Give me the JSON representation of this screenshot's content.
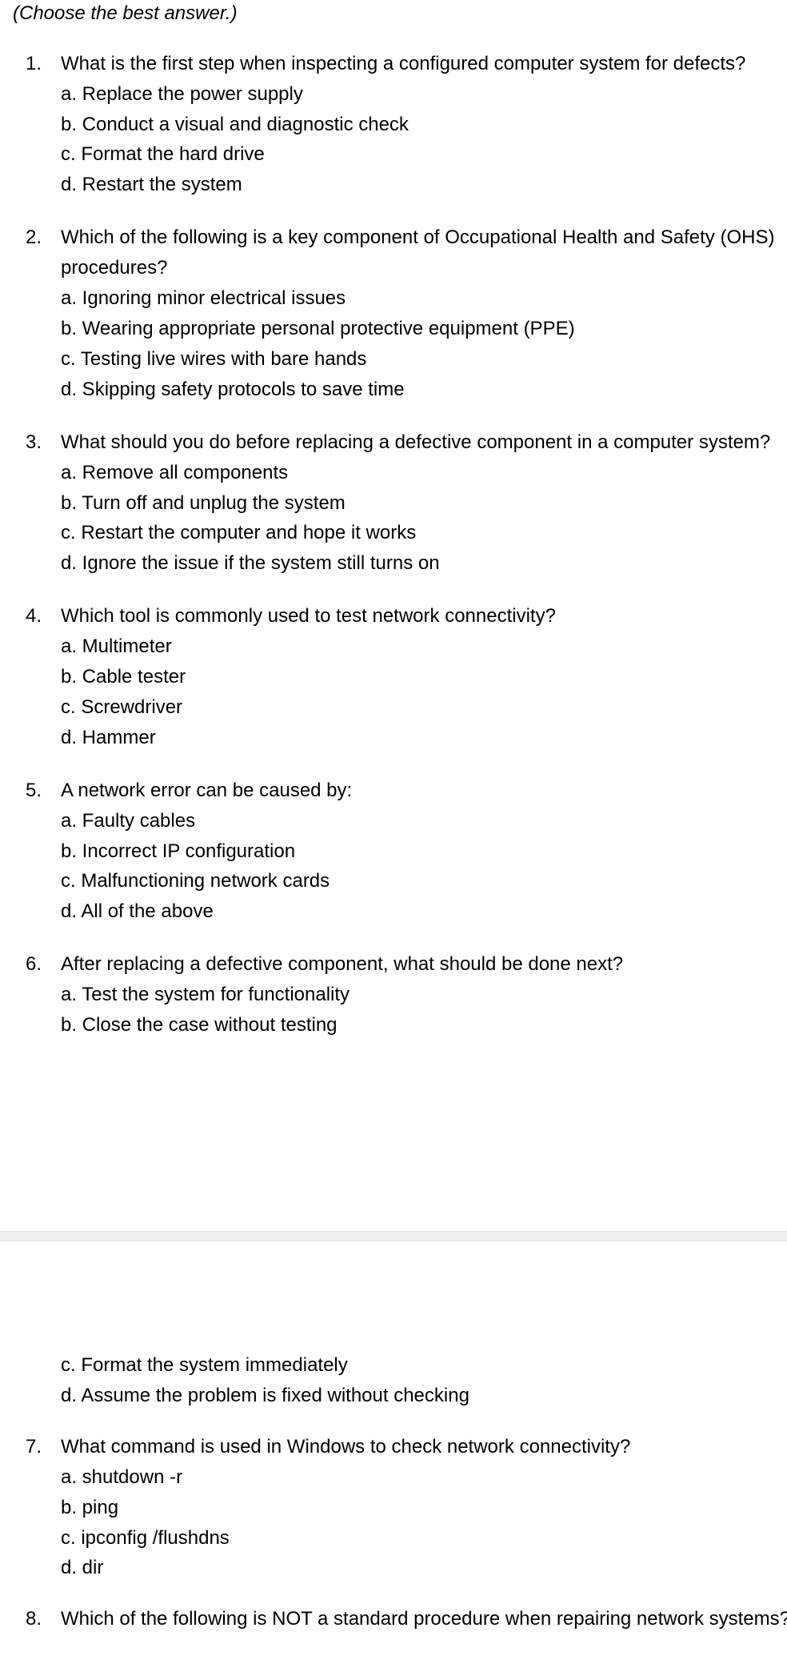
{
  "document": {
    "instruction": "(Choose the best answer.)",
    "page_break_color": "#eeeeee",
    "text_color": "#000000",
    "background_color": "#ffffff"
  },
  "page1": {
    "questions": [
      {
        "number": "1.",
        "text": "What is the first step when inspecting a configured computer system for defects?",
        "options": [
          "a. Replace the power supply",
          "b. Conduct a visual and diagnostic check",
          "c. Format the hard drive",
          "d. Restart the system"
        ]
      },
      {
        "number": "2.",
        "text": "Which of the following is a key component of Occupational Health and Safety (OHS) procedures?",
        "options": [
          "a. Ignoring minor electrical issues",
          "b. Wearing appropriate personal protective equipment (PPE)",
          "c. Testing live wires with bare hands",
          "d. Skipping safety protocols to save time"
        ]
      },
      {
        "number": "3.",
        "text": "What should you do before replacing a defective component in a computer system?",
        "options": [
          "a. Remove all components",
          "b. Turn off and unplug the system",
          "c. Restart the computer and hope it works",
          "d. Ignore the issue if the system still turns on"
        ]
      },
      {
        "number": "4.",
        "text": "Which tool is commonly used to test network connectivity?",
        "options": [
          "a. Multimeter",
          "b. Cable tester",
          "c. Screwdriver",
          "d. Hammer"
        ]
      },
      {
        "number": "5.",
        "text": "A network error can be caused by:",
        "options": [
          "a. Faulty cables",
          "b. Incorrect IP configuration",
          "c. Malfunctioning network cards",
          "d. All of the above"
        ]
      },
      {
        "number": "6.",
        "text": "After replacing a defective component, what should be done next?",
        "options": [
          "a. Test the system for functionality",
          "b. Close the case without testing"
        ]
      }
    ]
  },
  "page2": {
    "continued_options": [
      "c. Format the system immediately",
      "d. Assume the problem is fixed without checking"
    ],
    "questions": [
      {
        "number": "7.",
        "text": "What command is used in Windows to check network connectivity?",
        "options": [
          "a. shutdown -r",
          "b. ping",
          "c. ipconfig /flushdns",
          "d. dir"
        ]
      },
      {
        "number": "8.",
        "text": "Which of the following is NOT a standard procedure when repairing network systems?",
        "options": []
      }
    ]
  }
}
